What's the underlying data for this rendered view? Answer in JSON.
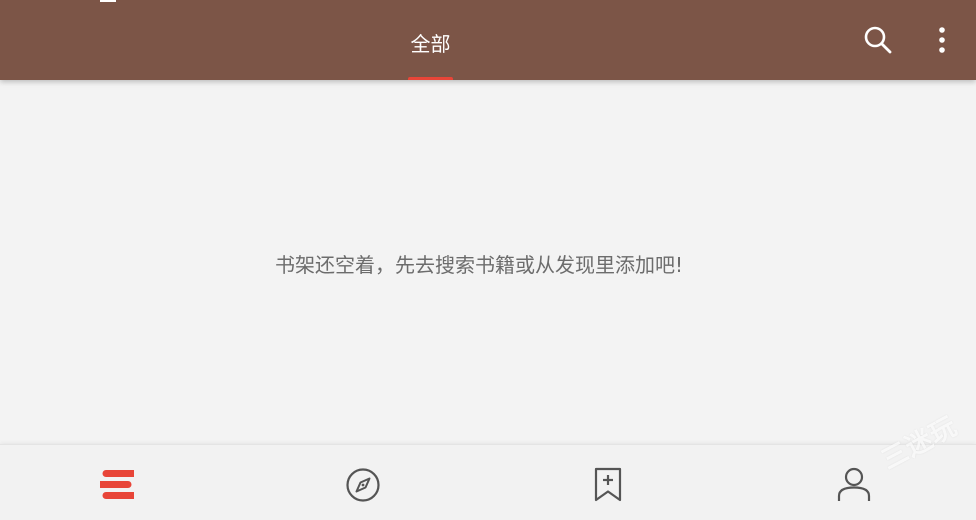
{
  "header": {
    "tabs": [
      {
        "label": "全部",
        "active": true
      }
    ],
    "background_color": "#7c5547",
    "indicator_color": "#e84538",
    "actions": [
      "search-icon",
      "more-vertical-icon"
    ]
  },
  "main": {
    "empty_message": "书架还空着，先去搜索书籍或从发现里添加吧!"
  },
  "bottom_nav": {
    "items": [
      {
        "name": "bookshelf",
        "icon": "bookshelf-icon",
        "active": true
      },
      {
        "name": "explore",
        "icon": "compass-icon",
        "active": false
      },
      {
        "name": "add-book",
        "icon": "bookmark-add-icon",
        "active": false
      },
      {
        "name": "profile",
        "icon": "person-icon",
        "active": false
      }
    ],
    "active_color": "#e84538",
    "inactive_color": "#555555"
  },
  "watermark": "三迷玩"
}
